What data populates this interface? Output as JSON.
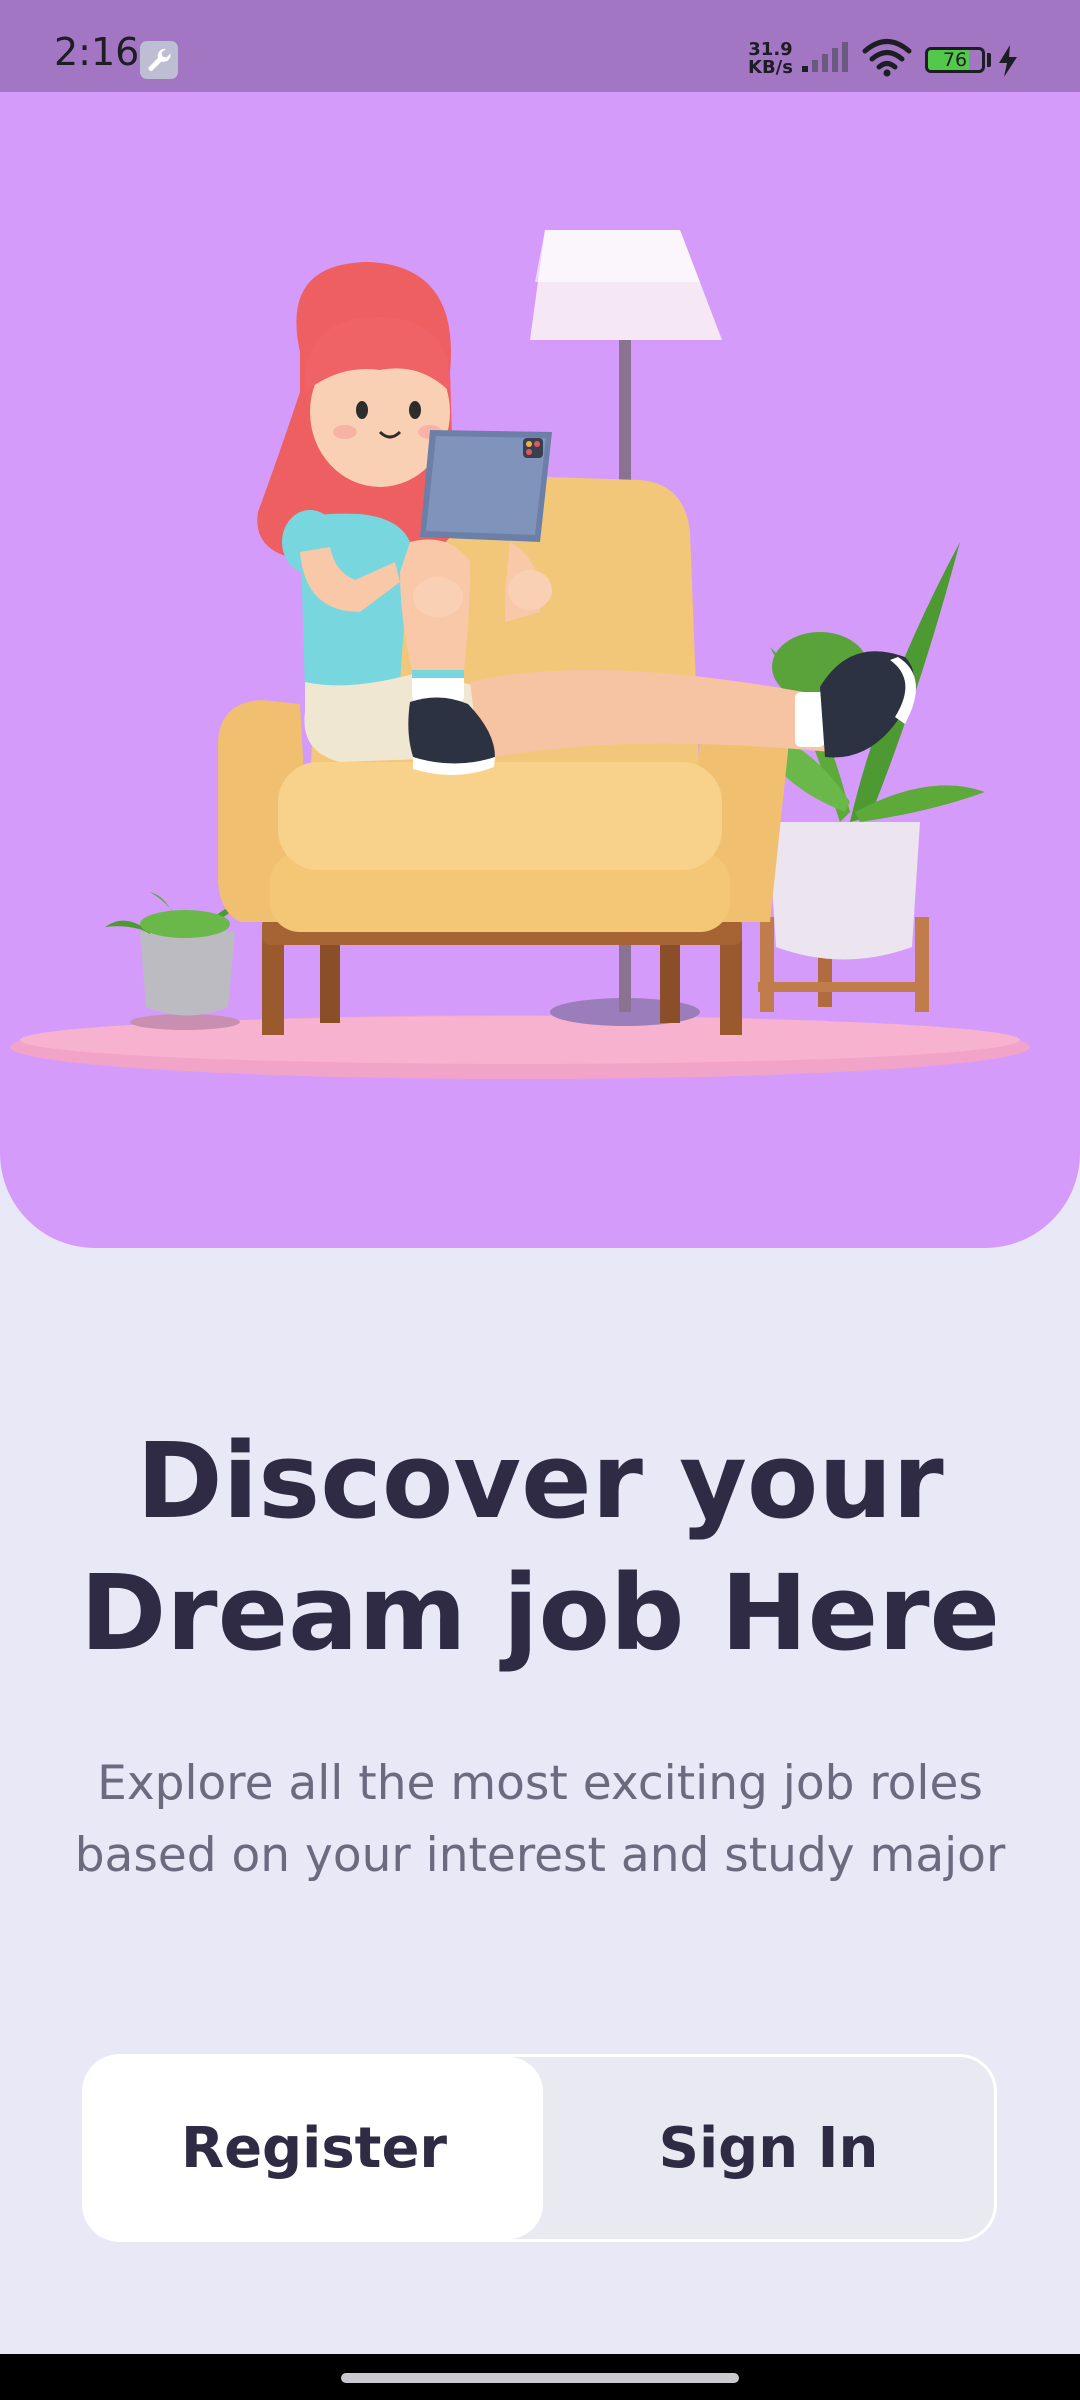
{
  "status_bar": {
    "time": "2:16",
    "net_speed_value": "31.9",
    "net_speed_unit": "KB/s",
    "battery_level": "76",
    "battery_fraction": 0.76,
    "icons": [
      "wrench-icon",
      "signal-icon",
      "wifi-icon",
      "battery-icon",
      "charging-bolt-icon"
    ]
  },
  "hero": {
    "illustration": "girl-on-armchair-with-tablet-illustration",
    "background_color": "#d59bfb"
  },
  "content": {
    "headline_line1": "Discover your",
    "headline_line2": "Dream job Here",
    "subtitle_line1": "Explore all the most exciting job roles",
    "subtitle_line2": "based on your interest and study major"
  },
  "auth": {
    "register_label": "Register",
    "signin_label": "Sign In",
    "selected": "register"
  },
  "colors": {
    "page_background": "#e8e8f6",
    "heading": "#2f2b45",
    "subtitle": "#6d6a80",
    "status_bar": "#a276c2"
  }
}
